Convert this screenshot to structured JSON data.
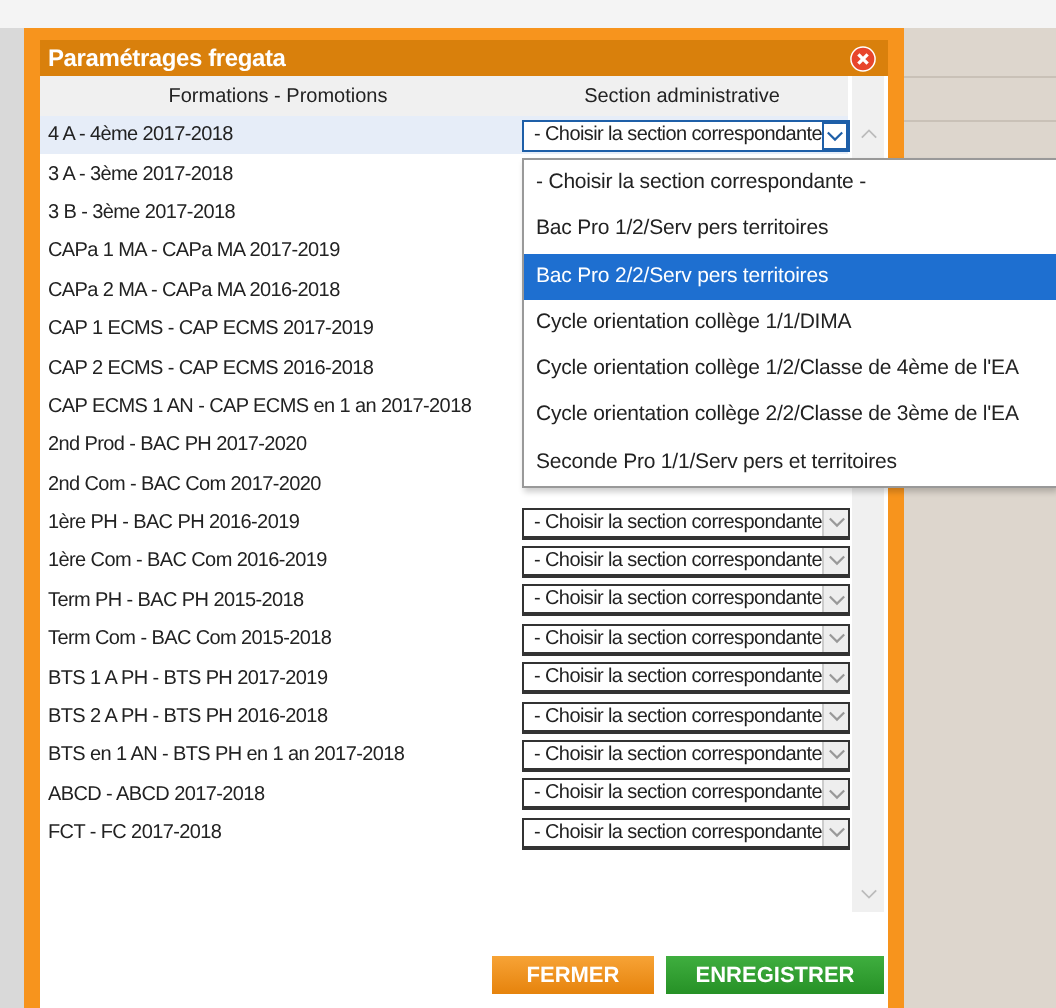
{
  "dialog": {
    "title": "Paramétrages fregata"
  },
  "columns": [
    "Formations - Promotions",
    "Section administrative"
  ],
  "rows": [
    {
      "formation": "4 A - 4ème 2017-2018",
      "selected": true,
      "section": {
        "value": "- Choisir la section correspondante",
        "open": true
      }
    },
    {
      "formation": "3 A - 3ème 2017-2018",
      "selected": false
    },
    {
      "formation": "3 B - 3ème 2017-2018",
      "selected": false
    },
    {
      "formation": "CAPa 1 MA - CAPa MA 2017-2019",
      "selected": false
    },
    {
      "formation": "CAPa 2 MA - CAPa MA 2016-2018",
      "selected": false
    },
    {
      "formation": "CAP 1 ECMS - CAP ECMS 2017-2019",
      "selected": false
    },
    {
      "formation": "CAP 2 ECMS - CAP ECMS 2016-2018",
      "selected": false
    },
    {
      "formation": "CAP ECMS 1 AN - CAP ECMS en 1 an 2017-2018",
      "selected": false
    },
    {
      "formation": "2nd Prod - BAC PH 2017-2020",
      "selected": false
    },
    {
      "formation": "2nd Com - BAC Com 2017-2020",
      "selected": false
    },
    {
      "formation": "1ère PH - BAC PH 2016-2019",
      "selected": false,
      "section": {
        "value": "- Choisir la section correspondante",
        "open": false
      }
    },
    {
      "formation": "1ère Com - BAC Com 2016-2019",
      "selected": false,
      "section": {
        "value": "- Choisir la section correspondante",
        "open": false
      }
    },
    {
      "formation": "Term PH - BAC PH 2015-2018",
      "selected": false,
      "section": {
        "value": "- Choisir la section correspondante",
        "open": false
      }
    },
    {
      "formation": "Term Com - BAC Com 2015-2018",
      "selected": false,
      "section": {
        "value": "- Choisir la section correspondante",
        "open": false
      }
    },
    {
      "formation": "BTS 1 A PH - BTS PH 2017-2019",
      "selected": false,
      "section": {
        "value": "- Choisir la section correspondante",
        "open": false
      }
    },
    {
      "formation": "BTS 2 A PH - BTS PH 2016-2018",
      "selected": false,
      "section": {
        "value": "- Choisir la section correspondante",
        "open": false
      }
    },
    {
      "formation": "BTS en 1 AN - BTS PH en 1 an 2017-2018",
      "selected": false,
      "section": {
        "value": "- Choisir la section correspondante",
        "open": false
      }
    },
    {
      "formation": "ABCD - ABCD 2017-2018",
      "selected": false,
      "section": {
        "value": "- Choisir la section correspondante",
        "open": false
      }
    },
    {
      "formation": "FCT - FC 2017-2018",
      "selected": false,
      "section": {
        "value": "- Choisir la section correspondante",
        "open": false
      }
    }
  ],
  "dropdown_options": [
    {
      "label": "- Choisir la section correspondante -",
      "selected": false
    },
    {
      "label": "Bac Pro 1/2/Serv pers territoires",
      "selected": false
    },
    {
      "label": "Bac Pro 2/2/Serv pers territoires",
      "selected": true
    },
    {
      "label": "Cycle orientation collège 1/1/DIMA",
      "selected": false
    },
    {
      "label": "Cycle orientation collège 1/2/Classe de 4ème de l'EA",
      "selected": false
    },
    {
      "label": "Cycle orientation collège 2/2/Classe de 3ème de l'EA",
      "selected": false
    },
    {
      "label": "Seconde Pro 1/1/Serv pers et territoires",
      "selected": false
    }
  ],
  "buttons": [
    {
      "label": "FERMER",
      "kind": "close"
    },
    {
      "label": "ENREGISTRER",
      "kind": "save"
    }
  ]
}
